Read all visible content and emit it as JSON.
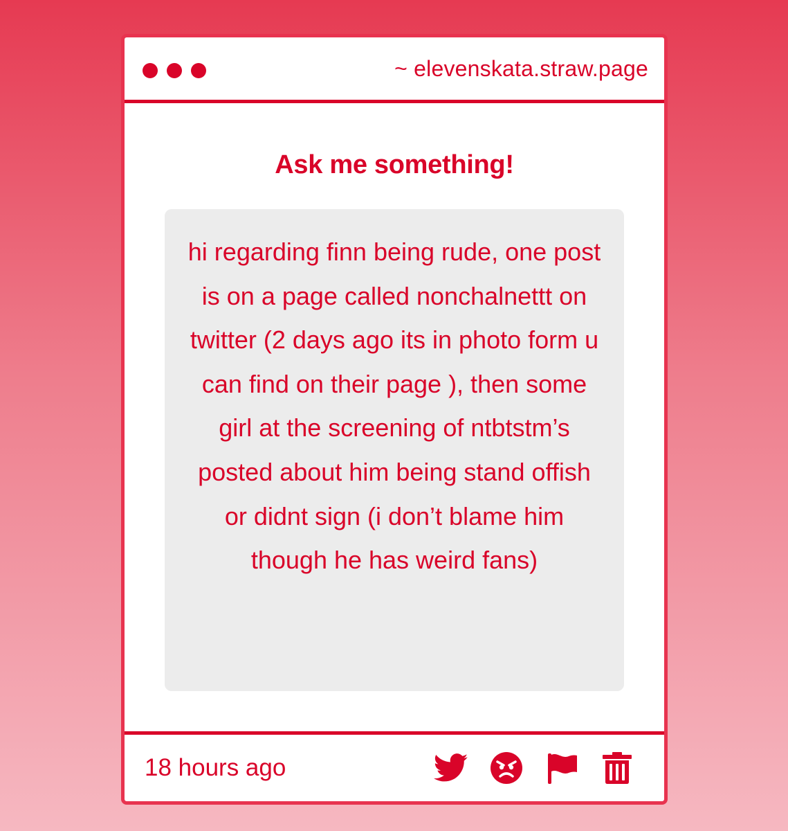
{
  "window": {
    "url": "~ elevenskata.straw.page"
  },
  "main": {
    "heading": "Ask me something!",
    "question": "hi regarding finn being rude, one post is on a page called nonchalnettt on twitter (2 days ago its in photo form u can find on their page ), then some girl at the screening of ntbtstm’s posted about him being stand offish or didnt sign (i don’t blame him though he has weird fans)"
  },
  "footer": {
    "timestamp": "18 hours ago",
    "actions": [
      {
        "name": "twitter-share",
        "icon": "twitter-bird-icon"
      },
      {
        "name": "angry-reaction",
        "icon": "angry-face-icon"
      },
      {
        "name": "report",
        "icon": "flag-icon"
      },
      {
        "name": "delete",
        "icon": "trash-icon"
      }
    ]
  },
  "colors": {
    "accent": "#d90429",
    "background_top": "#e63a52",
    "background_bottom": "#f6b8c1",
    "question_box": "#ececec",
    "card": "#ffffff"
  }
}
